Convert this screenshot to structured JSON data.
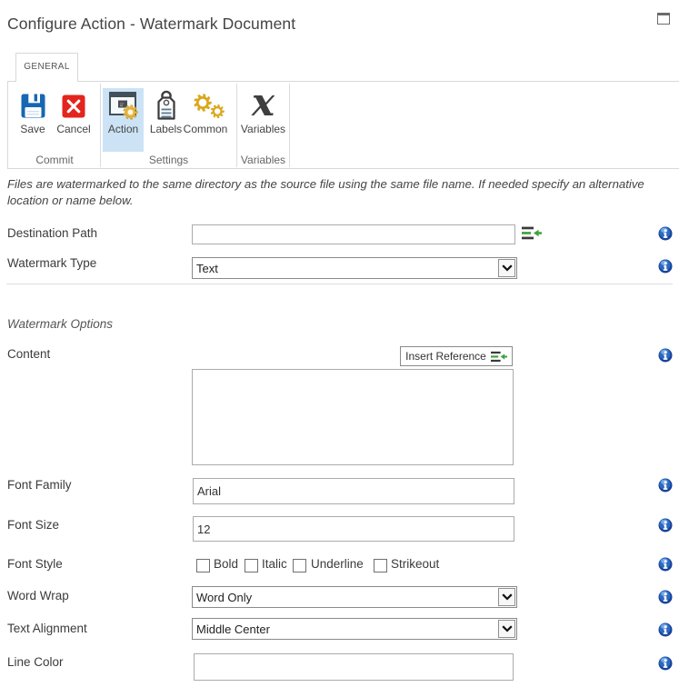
{
  "window": {
    "title": "Configure Action - Watermark Document"
  },
  "tabs": [
    {
      "label": "GENERAL",
      "active": true
    }
  ],
  "ribbon": {
    "groups": [
      {
        "label": "Commit",
        "buttons": [
          {
            "label": "Save",
            "icon": "save-icon"
          },
          {
            "label": "Cancel",
            "icon": "cancel-icon"
          }
        ]
      },
      {
        "label": "Settings",
        "buttons": [
          {
            "label": "Action",
            "icon": "action-icon",
            "active": true
          },
          {
            "label": "Labels",
            "icon": "labels-icon"
          },
          {
            "label": "Common",
            "icon": "common-icon"
          }
        ]
      },
      {
        "label": "Variables",
        "buttons": [
          {
            "label": "Variables",
            "icon": "variables-icon"
          }
        ]
      }
    ]
  },
  "description": {
    "lines": [
      "Files are watermarked to the same directory as the source file using the same file name. If needed specify an alternative",
      "location or name below."
    ]
  },
  "form": {
    "section_heading": "Watermark Options",
    "fields": [
      {
        "label": "Destination Path",
        "type": "text",
        "value": "",
        "icons": [
          "insert-reference-icon",
          "info-icon"
        ]
      },
      {
        "label": "Watermark Type",
        "type": "select",
        "value": "Text"
      },
      {
        "label": "Content",
        "type": "textarea",
        "value": "",
        "button_label": "Insert Reference"
      },
      {
        "label": "Font Family",
        "type": "text",
        "value": "Arial"
      },
      {
        "label": "Font Size",
        "type": "text",
        "value": "12"
      },
      {
        "label": "Font Style",
        "type": "checkboxes",
        "options": [
          "Bold",
          "Italic",
          "Underline",
          "Strikeout"
        ],
        "checked": [
          false,
          false,
          false,
          false
        ]
      },
      {
        "label": "Word Wrap",
        "type": "select",
        "value": "Word Only"
      },
      {
        "label": "Text Alignment",
        "type": "select",
        "value": "Middle Center"
      },
      {
        "label": "Line Color",
        "type": "text",
        "value": ""
      }
    ]
  },
  "colors": {
    "active_button_highlight": "#cbe3f5",
    "save_blue": "#1767b2",
    "cancel_red": "#e3251d",
    "gear_gold": "#dba81e",
    "info_blue": "#2f6cc4",
    "insert_reference_green": "#3fa23f",
    "border_gray": "#d8d8d8"
  }
}
